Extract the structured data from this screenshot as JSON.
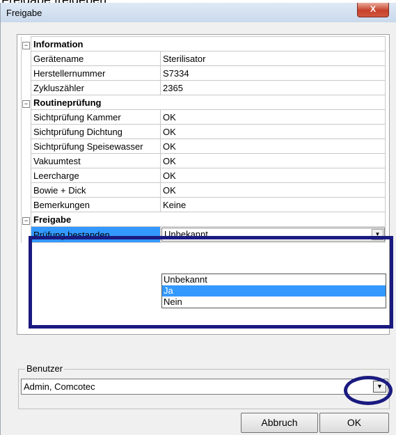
{
  "top_text": "Freigabe freigeben.",
  "window": {
    "title": "Freigabe",
    "close_glyph": "X"
  },
  "grid": {
    "categories": [
      {
        "title": "Information",
        "toggle": "−",
        "rows": [
          {
            "label": "Gerätename",
            "value": "Sterilisator"
          },
          {
            "label": "Herstellernummer",
            "value": "S7334"
          },
          {
            "label": "Zykluszähler",
            "value": "2365"
          }
        ]
      },
      {
        "title": "Routineprüfung",
        "toggle": "−",
        "rows": [
          {
            "label": "Sichtprüfung Kammer",
            "value": "OK"
          },
          {
            "label": "Sichtprüfung Dichtung",
            "value": "OK"
          },
          {
            "label": "Sichtprüfung Speisewasser",
            "value": "OK"
          },
          {
            "label": "Vakuumtest",
            "value": "OK"
          },
          {
            "label": "Leercharge",
            "value": "OK"
          },
          {
            "label": "Bowie + Dick",
            "value": "OK"
          },
          {
            "label": "Bemerkungen",
            "value": "Keine"
          }
        ]
      },
      {
        "title": "Freigabe",
        "toggle": "−",
        "rows": [
          {
            "label": "Prüfung bestanden",
            "value": "Unbekannt"
          }
        ]
      }
    ]
  },
  "dropdown": {
    "options": [
      "Unbekannt",
      "Ja",
      "Nein"
    ],
    "highlighted": "Ja"
  },
  "benutzer": {
    "label": "Benutzer",
    "value": "Admin, Comcotec"
  },
  "buttons": {
    "cancel": "Abbruch",
    "ok": "OK"
  },
  "arrow_glyph": "▼",
  "colors": {
    "highlight_box": "#1a1a80",
    "selection": "#3399ff"
  }
}
